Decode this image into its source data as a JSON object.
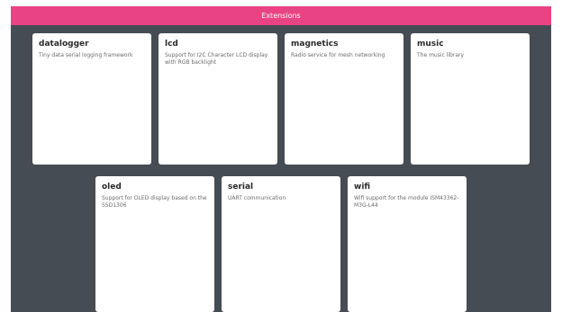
{
  "header": {
    "title": "Extensions"
  },
  "extensions": [
    {
      "name": "datalogger",
      "description": "Tiny data serial logging framework"
    },
    {
      "name": "lcd",
      "description": "Support for I2C Character LCD display with RGB backlight"
    },
    {
      "name": "magnetics",
      "description": "Radio service for mesh networking"
    },
    {
      "name": "music",
      "description": "The music library"
    },
    {
      "name": "oled",
      "description": "Support for OLED display based on the SSD1306"
    },
    {
      "name": "serial",
      "description": "UART communication"
    },
    {
      "name": "wifi",
      "description": "Wifi support for the module ISM43362-M3G-L44"
    }
  ],
  "colors": {
    "header_bg": "#ea4383",
    "background": "#464c54",
    "card_bg": "#ffffff"
  }
}
